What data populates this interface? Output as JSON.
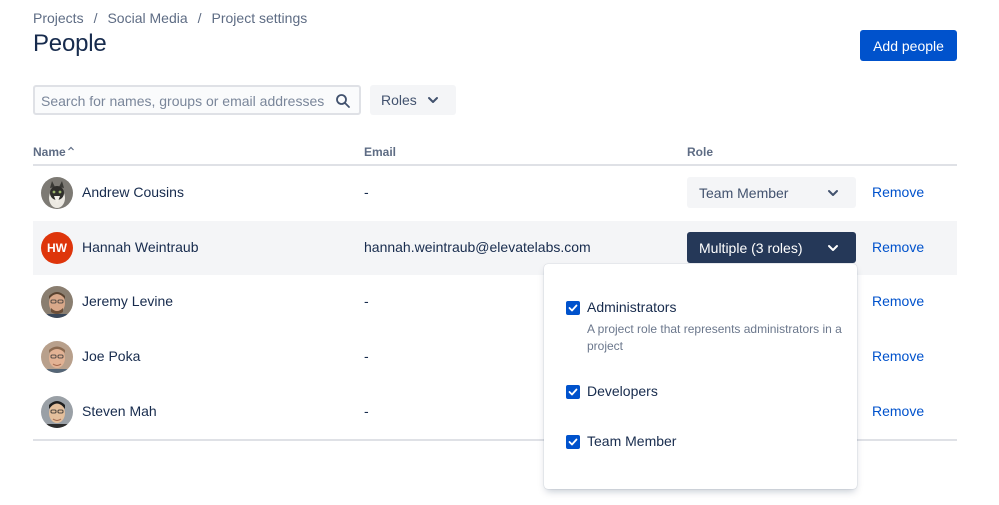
{
  "breadcrumb": [
    "Projects",
    "Social Media",
    "Project settings"
  ],
  "breadcrumb_separator": "/",
  "page_title": "People",
  "add_button": "Add people",
  "search": {
    "placeholder": "Search for names, groups or email addresses",
    "value": "",
    "icon": "search-icon"
  },
  "roles_filter": {
    "label": "Roles",
    "icon": "chevron-down-icon"
  },
  "table": {
    "headers": {
      "name": "Name",
      "email": "Email",
      "role": "Role"
    },
    "sort_indicator": "ascending",
    "rows": [
      {
        "name": "Andrew Cousins",
        "email": "-",
        "role": "Team Member",
        "remove": "Remove",
        "avatar": "photo"
      },
      {
        "name": "Hannah Weintraub",
        "email": "hannah.weintraub@elevatelabs.com",
        "role": "Multiple (3 roles)",
        "remove": "Remove",
        "avatar": "HW"
      },
      {
        "name": "Jeremy Levine",
        "email": "-",
        "role": "",
        "remove": "Remove",
        "avatar": "photo"
      },
      {
        "name": "Joe Poka",
        "email": "-",
        "role": "",
        "remove": "Remove",
        "avatar": "photo"
      },
      {
        "name": "Steven Mah",
        "email": "-",
        "role": "",
        "remove": "Remove",
        "avatar": "photo"
      }
    ]
  },
  "role_dropdown": {
    "options": [
      {
        "label": "Administrators",
        "description": "A project role that represents administrators in a project",
        "checked": true
      },
      {
        "label": "Developers",
        "description": "",
        "checked": true
      },
      {
        "label": "Team Member",
        "description": "",
        "checked": true
      }
    ]
  },
  "colors": {
    "primary": "#0052cc",
    "active_select": "#253858",
    "text": "#172b4d",
    "subtle": "#5e6c84",
    "avatar_hw": "#de350b"
  }
}
